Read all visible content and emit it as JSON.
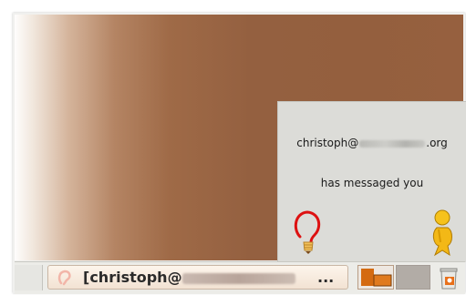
{
  "notification": {
    "sender_prefix": "christoph@",
    "sender_suffix": ".org",
    "message": "has messaged you",
    "icons": [
      "lightbulb-icon",
      "buddy-icon"
    ]
  },
  "taskbar": {
    "task": {
      "label_prefix": "[christoph@",
      "ellipsis": "...",
      "icon": "ear-icon"
    },
    "workspaces": [
      "workspace-1",
      "workspace-2"
    ],
    "trash_icon": "trash-icon"
  },
  "colors": {
    "desktop_brown": "#945f3e",
    "notification_bg": "#dcdcd8",
    "accent_orange": "#e07a1e"
  }
}
